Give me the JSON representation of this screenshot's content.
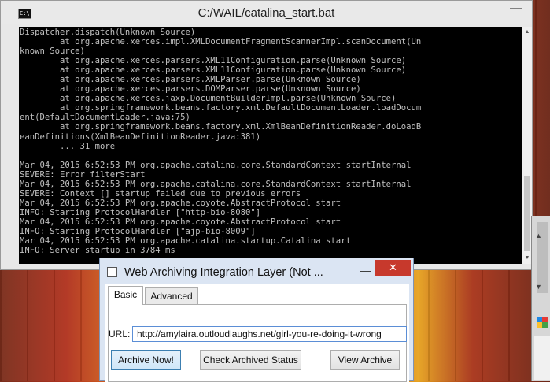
{
  "console": {
    "title": "C:/WAIL/catalina_start.bat",
    "system_icon_text": "C:\\",
    "minimize_glyph": "—",
    "lines": [
      "Dispatcher.dispatch(Unknown Source)",
      "        at org.apache.xerces.impl.XMLDocumentFragmentScannerImpl.scanDocument(Un",
      "known Source)",
      "        at org.apache.xerces.parsers.XML11Configuration.parse(Unknown Source)",
      "        at org.apache.xerces.parsers.XML11Configuration.parse(Unknown Source)",
      "        at org.apache.xerces.parsers.XMLParser.parse(Unknown Source)",
      "        at org.apache.xerces.parsers.DOMParser.parse(Unknown Source)",
      "        at org.apache.xerces.jaxp.DocumentBuilderImpl.parse(Unknown Source)",
      "        at org.springframework.beans.factory.xml.DefaultDocumentLoader.loadDocum",
      "ent(DefaultDocumentLoader.java:75)",
      "        at org.springframework.beans.factory.xml.XmlBeanDefinitionReader.doLoadB",
      "eanDefinitions(XmlBeanDefinitionReader.java:381)",
      "        ... 31 more",
      "",
      "Mar 04, 2015 6:52:53 PM org.apache.catalina.core.StandardContext startInternal",
      "SEVERE: Error filterStart",
      "Mar 04, 2015 6:52:53 PM org.apache.catalina.core.StandardContext startInternal",
      "SEVERE: Context [] startup failed due to previous errors",
      "Mar 04, 2015 6:52:53 PM org.apache.coyote.AbstractProtocol start",
      "INFO: Starting ProtocolHandler [\"http-bio-8080\"]",
      "Mar 04, 2015 6:52:53 PM org.apache.coyote.AbstractProtocol start",
      "INFO: Starting ProtocolHandler [\"ajp-bio-8009\"]",
      "Mar 04, 2015 6:52:53 PM org.apache.catalina.startup.Catalina start",
      "INFO: Server startup in 3784 ms"
    ]
  },
  "dialog": {
    "title": "Web Archiving Integration Layer (Not ...",
    "minimize_glyph": "—",
    "close_glyph": "✕",
    "tabs": [
      {
        "label": "Basic",
        "active": true
      },
      {
        "label": "Advanced",
        "active": false
      }
    ],
    "url_label": "URL:",
    "url_value": "http://amylaira.outloudlaughs.net/girl-you-re-doing-it-wrong",
    "buttons": {
      "archive_now": "Archive Now!",
      "check_status": "Check Archived Status",
      "view_archive": "View Archive"
    }
  },
  "colors": {
    "console_bg": "#000000",
    "console_fg": "#c0c0c0",
    "dialog_frame": "#dbe5f3",
    "close_button": "#c7392c"
  }
}
